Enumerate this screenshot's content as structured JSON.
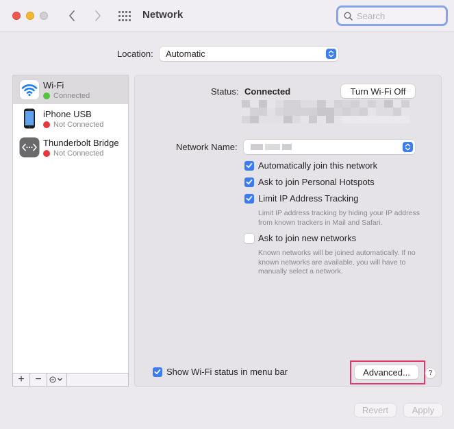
{
  "window": {
    "title": "Network",
    "search_placeholder": "Search",
    "icons": {
      "back": "chevron-left-icon",
      "forward": "chevron-right-icon",
      "show_all": "grid-icon",
      "search": "magnifier-icon"
    }
  },
  "location": {
    "label": "Location:",
    "value": "Automatic"
  },
  "services": [
    {
      "name": "Wi-Fi",
      "status": "Connected",
      "status_color": "#56c33f",
      "icon": "wifi-icon",
      "selected": true
    },
    {
      "name": "iPhone USB",
      "status": "Not Connected",
      "status_color": "#e6383d",
      "icon": "iphone-icon",
      "selected": false
    },
    {
      "name": "Thunderbolt Bridge",
      "status": "Not Connected",
      "status_color": "#e6383d",
      "icon": "thunderbolt-bridge-icon",
      "selected": false
    }
  ],
  "sidebar_toolbar": {
    "add": "+",
    "remove": "−",
    "action": "⊖⌄"
  },
  "detail": {
    "status_label": "Status:",
    "status_value": "Connected",
    "turn_off_label": "Turn Wi-Fi Off",
    "network_name_label": "Network Name:",
    "options": [
      {
        "label": "Automatically join this network",
        "checked": true
      },
      {
        "label": "Ask to join Personal Hotspots",
        "checked": true
      },
      {
        "label": "Limit IP Address Tracking",
        "checked": true,
        "help": "Limit IP address tracking by hiding your IP address from known trackers in Mail and Safari."
      },
      {
        "label": "Ask to join new networks",
        "checked": false,
        "help": "Known networks will be joined automatically. If no known networks are available, you will have to manually select a network."
      }
    ],
    "show_menu_bar": {
      "label": "Show Wi-Fi status in menu bar",
      "checked": true
    },
    "advanced_label": "Advanced...",
    "help_label": "?"
  },
  "footer": {
    "revert_label": "Revert",
    "apply_label": "Apply"
  },
  "colors": {
    "accent": "#3b7cf0",
    "highlight": "#e5386a",
    "search_focus": "#86a5e8"
  }
}
